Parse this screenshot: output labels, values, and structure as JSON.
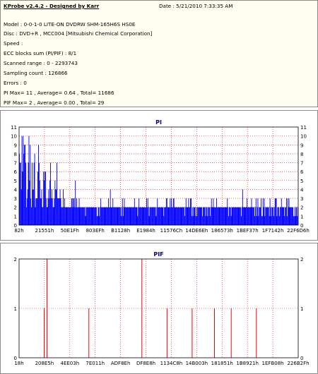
{
  "header": {
    "title": "KProbe v2.4.2 - Designed by Karr",
    "date": "Date : 5/21/2010 7:33:35 AM"
  },
  "info_lines": [
    "Model : 0-0-1-0 LITE-ON DVDRW SHM-165H6S HS0E",
    "Disc : DVD+R , MCC004 [Mitsubishi Chemical Corporation]",
    "Speed :",
    "ECC blocks sum (PI/PIF) : 8/1",
    "Scanned range : 0 - 2293743",
    "Sampling count : 126866",
    "Errors : 0",
    "PI Max= 11 , Average= 0.64 , Total= 11686",
    "PIF Max= 2 , Average= 0.00 , Total= 29"
  ],
  "colors": {
    "pi_bar": "#0000ff",
    "pif_bar": "#ff0000",
    "grid": "#ff0000",
    "title": "#000080"
  },
  "chart_data": [
    {
      "type": "bar",
      "title": "PI",
      "ylim": [
        0,
        11
      ],
      "y_ticks": [
        "0",
        "1",
        "2",
        "3",
        "4",
        "5",
        "6",
        "7",
        "8",
        "9",
        "10",
        "11"
      ],
      "x_ticks": [
        "82h",
        "21551h",
        "50E1Fh",
        "803EFh",
        "B1128h",
        "E1984h",
        "11576Ch",
        "14DE6Eh",
        "186573h",
        "1BEF37h",
        "1F7142h",
        "22F6D6h"
      ],
      "grid": true,
      "sample_range": [
        0,
        2293743
      ],
      "baseline_level": 2,
      "max": 11,
      "average": 0.64,
      "peak_samples": [
        {
          "pos": 0.0,
          "value": 11
        },
        {
          "pos": 0.01,
          "value": 10
        },
        {
          "pos": 0.02,
          "value": 9
        },
        {
          "pos": 0.035,
          "value": 10
        },
        {
          "pos": 0.05,
          "value": 8
        },
        {
          "pos": 0.07,
          "value": 7
        },
        {
          "pos": 0.09,
          "value": 6
        },
        {
          "pos": 0.11,
          "value": 7
        },
        {
          "pos": 0.13,
          "value": 5
        },
        {
          "pos": 0.16,
          "value": 4
        },
        {
          "pos": 0.2,
          "value": 5
        },
        {
          "pos": 0.24,
          "value": 4
        },
        {
          "pos": 0.28,
          "value": 4
        },
        {
          "pos": 0.33,
          "value": 4
        },
        {
          "pos": 0.38,
          "value": 4
        },
        {
          "pos": 0.41,
          "value": 4
        },
        {
          "pos": 0.46,
          "value": 4
        },
        {
          "pos": 0.5,
          "value": 4
        },
        {
          "pos": 0.55,
          "value": 4
        },
        {
          "pos": 0.6,
          "value": 4
        },
        {
          "pos": 0.65,
          "value": 4
        },
        {
          "pos": 0.7,
          "value": 4
        },
        {
          "pos": 0.75,
          "value": 4
        },
        {
          "pos": 0.8,
          "value": 4
        },
        {
          "pos": 0.86,
          "value": 3
        },
        {
          "pos": 0.92,
          "value": 4
        },
        {
          "pos": 0.97,
          "value": 3
        }
      ]
    },
    {
      "type": "bar",
      "title": "PIF",
      "ylim": [
        0,
        2
      ],
      "y_ticks": [
        "0",
        "1",
        "2"
      ],
      "x_ticks": [
        "18h",
        "208E5h",
        "4EE03h",
        "7E011h",
        "ADF8Eh",
        "DF8E8h",
        "1134C8h",
        "14B003h",
        "181851h",
        "1B8921h",
        "1EFB08h",
        "226B2Fh"
      ],
      "grid": true,
      "max": 2,
      "average": 0.0,
      "total": 29,
      "points": [
        {
          "pos": 0.09,
          "value": 1
        },
        {
          "pos": 0.1,
          "value": 2
        },
        {
          "pos": 0.25,
          "value": 1
        },
        {
          "pos": 0.44,
          "value": 2
        },
        {
          "pos": 0.53,
          "value": 1
        },
        {
          "pos": 0.62,
          "value": 1
        },
        {
          "pos": 0.7,
          "value": 1
        },
        {
          "pos": 0.76,
          "value": 1
        },
        {
          "pos": 0.85,
          "value": 1
        }
      ]
    }
  ]
}
